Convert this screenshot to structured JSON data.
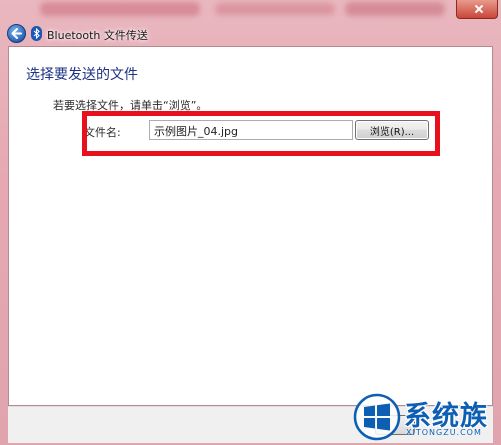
{
  "window": {
    "title": "Bluetooth 文件传送"
  },
  "main": {
    "heading": "选择要发送的文件",
    "instruction": "若要选择文件，请单击“浏览”。",
    "file_label": "文件名:",
    "file_value": "示例图片_04.jpg",
    "browse_label": "浏览(R)..."
  },
  "watermark": {
    "brand": "系统族",
    "url": "XITONGZU.COM"
  },
  "colors": {
    "frame": "#e6a9b3",
    "heading": "#1e3287",
    "highlight": "#e8101c",
    "watermark": "#0d5fb3"
  },
  "icons": [
    "back-arrow-icon",
    "bluetooth-icon",
    "close-icon",
    "windows-logo-icon"
  ]
}
